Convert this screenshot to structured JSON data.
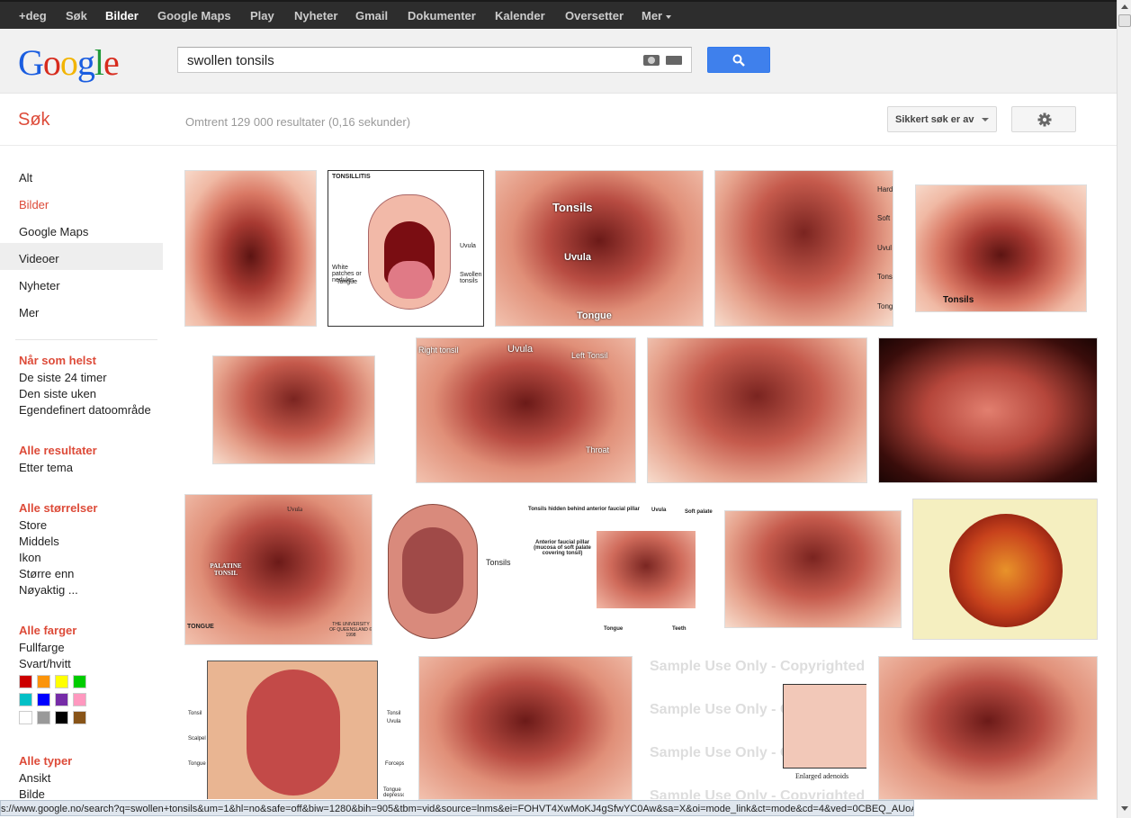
{
  "topnav": {
    "items": [
      "+deg",
      "Søk",
      "Bilder",
      "Google Maps",
      "Play",
      "Nyheter",
      "Gmail",
      "Dokumenter",
      "Kalender",
      "Oversetter",
      "Mer"
    ],
    "active_index": 2
  },
  "logo": {
    "letters": [
      "G",
      "o",
      "o",
      "g",
      "l",
      "e"
    ]
  },
  "search": {
    "query": "swollen tonsils"
  },
  "subbar": {
    "title": "Søk",
    "result_stats": "Omtrent 129 000 resultater (0,16 sekunder)",
    "safesearch_label": "Sikkert søk er av"
  },
  "leftnav": {
    "items": [
      "Alt",
      "Bilder",
      "Google Maps",
      "Videoer",
      "Nyheter",
      "Mer"
    ],
    "selected_index": 1,
    "hover_index": 3
  },
  "filters": {
    "time": {
      "heading": "Når som helst",
      "items": [
        "De siste 24 timer",
        "Den siste uken",
        "Egendefinert datoområde"
      ]
    },
    "results": {
      "heading": "Alle resultater",
      "items": [
        "Etter tema"
      ]
    },
    "sizes": {
      "heading": "Alle størrelser",
      "items": [
        "Store",
        "Middels",
        "Ikon",
        "Større enn",
        "Nøyaktig ..."
      ]
    },
    "colors": {
      "heading": "Alle farger",
      "items": [
        "Fullfarge",
        "Svart/hvitt"
      ],
      "swatches": [
        "#cc0000",
        "#fb940b",
        "#ffff00",
        "#00cc00",
        "#03c0c6",
        "#0000ff",
        "#762ca7",
        "#ff98bf",
        "#ffffff",
        "#999999",
        "#000000",
        "#885418"
      ]
    },
    "types": {
      "heading": "Alle typer",
      "items": [
        "Ansikt",
        "Bilde"
      ]
    }
  },
  "images": {
    "labels": {
      "tonsillitis": "TONSILLITIS",
      "white_patches": "White patches or nodules",
      "uvula": "Uvula",
      "tongue": "Tongue",
      "swollen_tonsils": "Swollen tonsils",
      "tonsils": "Tonsils",
      "hard": "Hard",
      "soft": "Soft",
      "uvul": "Uvul",
      "tons": "Tons",
      "tong": "Tong",
      "right_tonsil": "Right tonsil",
      "left_tonsil": "Left Tonsil",
      "throat": "Throat",
      "palatine_tonsil": "PALATINE TONSIL",
      "tongue_caps": "TONGUE",
      "university": "THE UNIVERSITY OF QUEENSLAND © 1998",
      "hidden_tonsils": "Tonsils hidden behind anterior faucial pillar",
      "soft_palate": "Soft palate",
      "anterior_pillar": "Anterior faucial pillar (mucosa of soft palate covering tonsil)",
      "teeth": "Teeth",
      "tonsil": "Tonsil",
      "scalpel": "Scalpel",
      "forceps": "Forceps",
      "tongue_depressor": "Tongue depressor",
      "sample_use": "Sample Use Only - Copyrighted",
      "enlarged_adenoids": "Enlarged adenoids"
    }
  },
  "statusbar": {
    "url": "s://www.google.no/search?q=swollen+tonsils&um=1&hl=no&safe=off&biw=1280&bih=905&tbm=vid&source=lnms&ei=FOHVT4XwMoKJ4gSfwYC0Aw&sa=X&oi=mode_link&ct=mode&cd=4&ved=0CBEQ_AUoAw"
  }
}
